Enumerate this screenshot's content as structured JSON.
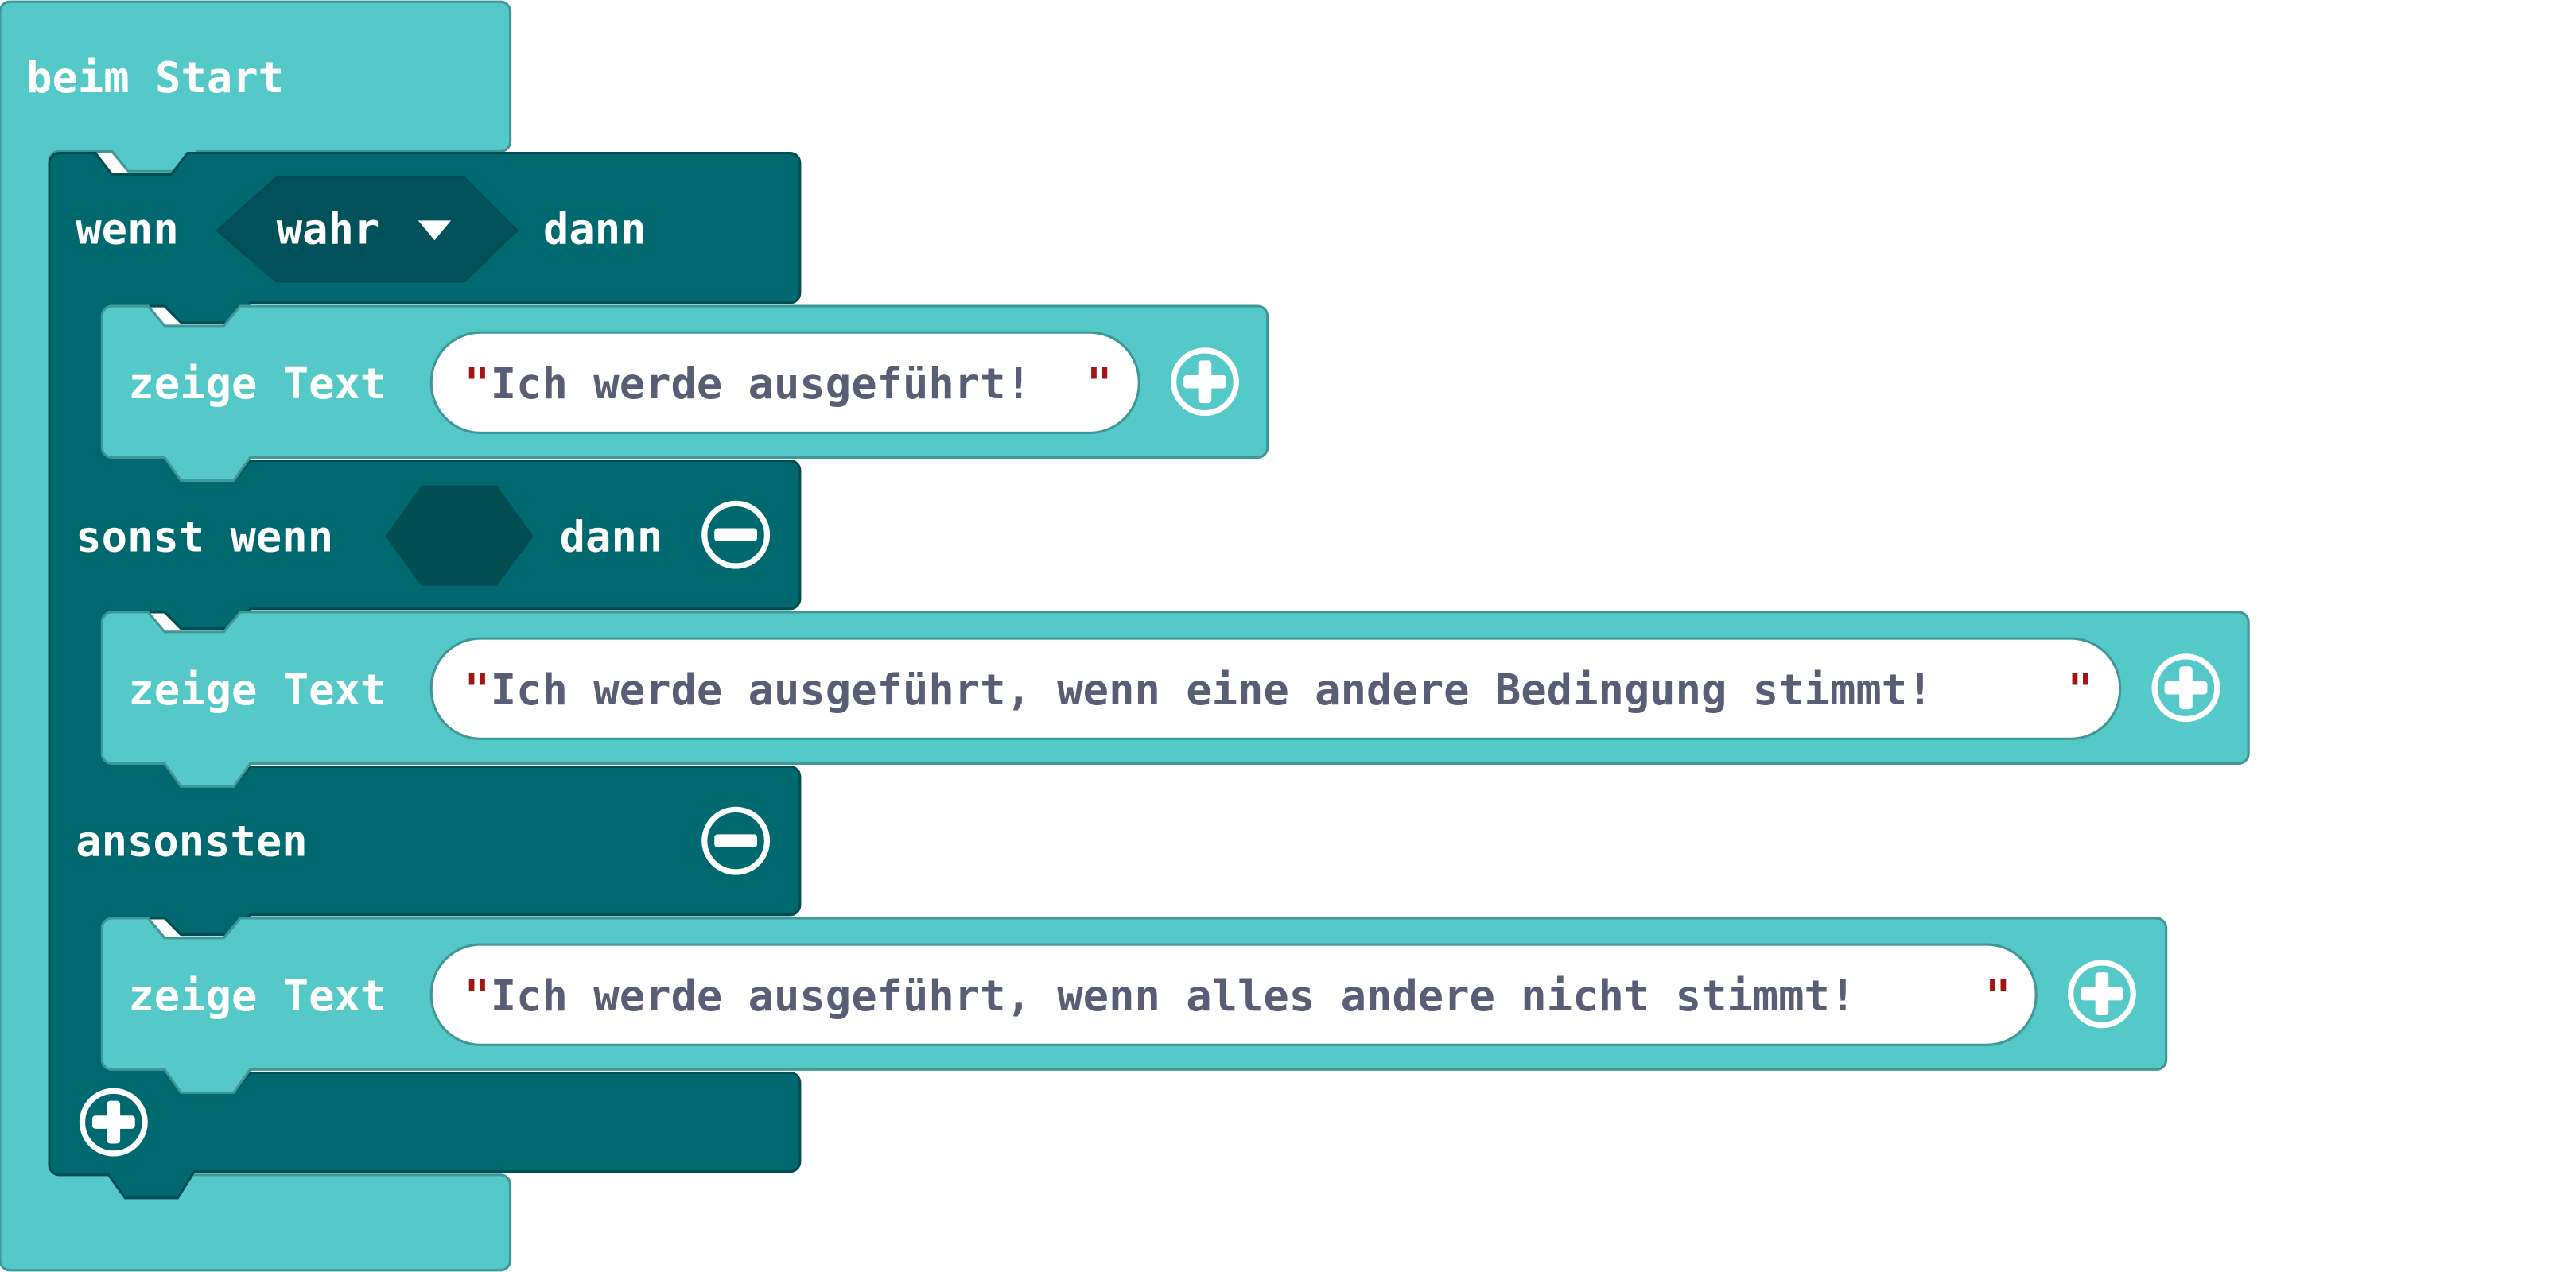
{
  "colors": {
    "event_block": "#55c8c8",
    "event_border": "#3f9797",
    "logic_block": "#006970",
    "logic_border": "#004d52",
    "logic_slot": "#005159",
    "string_field_bg": "#ffffff",
    "string_text": "#575e75",
    "quote_mark": "#a31515",
    "label_text": "#ffffff"
  },
  "event_block": {
    "label": "beim Start"
  },
  "if_block": {
    "if_label": "wenn",
    "condition_value": "wahr",
    "condition_dropdown_icon": "triangle-down-icon",
    "then_label": "dann",
    "elseif_label": "sonst wenn",
    "elseif_then_label": "dann",
    "else_label": "ansonsten",
    "remove_icon": "minus-circle-icon",
    "add_icon": "plus-circle-icon"
  },
  "show_text_blocks": [
    {
      "label": "zeige Text",
      "value": "Ich werde ausgeführt!",
      "quote_open": "\"",
      "quote_close": "\""
    },
    {
      "label": "zeige Text",
      "value": "Ich werde ausgeführt, wenn eine andere Bedingung stimmt!",
      "quote_open": "\"",
      "quote_close": "\""
    },
    {
      "label": "zeige Text",
      "value": "Ich werde ausgeführt, wenn alles andere nicht stimmt!",
      "quote_open": "\"",
      "quote_close": "\""
    }
  ]
}
